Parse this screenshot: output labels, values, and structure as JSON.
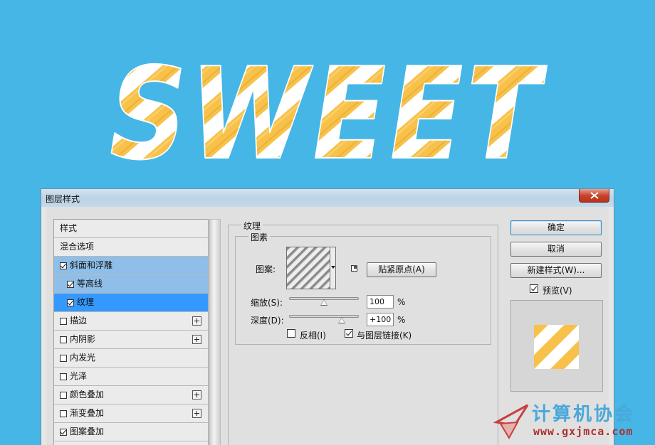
{
  "artwork": {
    "text": "SWEET"
  },
  "dialog": {
    "title": "图层样式",
    "styles": [
      {
        "label": "样式",
        "checkbox": false,
        "checked": false,
        "indent": false,
        "plus": false,
        "state": ""
      },
      {
        "label": "混合选项",
        "checkbox": false,
        "checked": false,
        "indent": false,
        "plus": false,
        "state": ""
      },
      {
        "label": "斜面和浮雕",
        "checkbox": true,
        "checked": true,
        "indent": false,
        "plus": false,
        "state": "sel-light"
      },
      {
        "label": "等高线",
        "checkbox": true,
        "checked": true,
        "indent": true,
        "plus": false,
        "state": "sel-light"
      },
      {
        "label": "纹理",
        "checkbox": true,
        "checked": true,
        "indent": true,
        "plus": false,
        "state": "sel-strong"
      },
      {
        "label": "描边",
        "checkbox": true,
        "checked": false,
        "indent": false,
        "plus": true,
        "state": ""
      },
      {
        "label": "内阴影",
        "checkbox": true,
        "checked": false,
        "indent": false,
        "plus": true,
        "state": ""
      },
      {
        "label": "内发光",
        "checkbox": true,
        "checked": false,
        "indent": false,
        "plus": false,
        "state": ""
      },
      {
        "label": "光泽",
        "checkbox": true,
        "checked": false,
        "indent": false,
        "plus": false,
        "state": ""
      },
      {
        "label": "颜色叠加",
        "checkbox": true,
        "checked": false,
        "indent": false,
        "plus": true,
        "state": ""
      },
      {
        "label": "渐变叠加",
        "checkbox": true,
        "checked": false,
        "indent": false,
        "plus": true,
        "state": ""
      },
      {
        "label": "图案叠加",
        "checkbox": true,
        "checked": true,
        "indent": false,
        "plus": false,
        "state": ""
      }
    ],
    "texture": {
      "group_title": "纹理",
      "subgroup_title": "图素",
      "pattern_label": "图案:",
      "snap_button": "贴紧原点(A)",
      "scale_label": "缩放(S):",
      "scale_value": "100",
      "scale_unit": "%",
      "scale_level": 0.5,
      "depth_label": "深度(D):",
      "depth_value": "+100",
      "depth_unit": "%",
      "depth_level": 0.75,
      "invert_label": "反相(I)",
      "invert_checked": false,
      "link_label": "与图层链接(K)",
      "link_checked": true
    },
    "buttons": {
      "ok": "确定",
      "cancel": "取消",
      "new_style": "新建样式(W)..."
    },
    "preview": {
      "label": "预览(V)",
      "checked": true
    }
  },
  "watermark": {
    "title": "计算机协会",
    "url": "www.gxjmca.com"
  },
  "colors": {
    "background": "#45b6e6",
    "candy_stripe": "#f7c14a",
    "selection": "#3399ff",
    "selection_light": "#8fbfe8"
  }
}
